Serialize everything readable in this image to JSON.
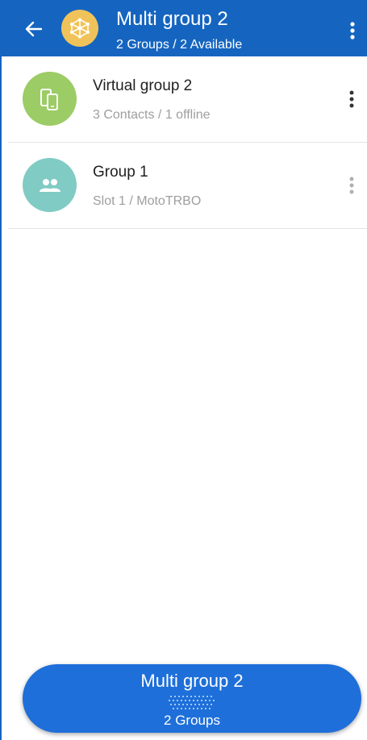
{
  "app_bar": {
    "back_icon": "arrow-back-icon",
    "avatar_icon": "multi-group-network-icon",
    "avatar_color": "#f0c35a",
    "title": "Multi group 2",
    "subtitle": "2 Groups /  2 Available",
    "menu_icon": "more-vert-icon",
    "background": "#1565c0"
  },
  "list": {
    "items": [
      {
        "title": "Virtual group 2",
        "subtitle": "3 Contacts / 1 offline",
        "icon": "mobile-devices-icon",
        "avatar_color": "#9ccc65",
        "menu_icon": "more-vert-icon",
        "menu_color": "#333333"
      },
      {
        "title": "Group 1",
        "subtitle": "Slot 1 / MotoTRBO",
        "icon": "people-icon",
        "avatar_color": "#80cbc4",
        "menu_icon": "more-vert-icon",
        "menu_color": "#b0b0b0"
      }
    ]
  },
  "bottom_bar": {
    "title": "Multi group 2",
    "grip_icon": "drag-handle-dots-icon",
    "subtitle": "2 Groups",
    "background": "#1e6fd9"
  }
}
